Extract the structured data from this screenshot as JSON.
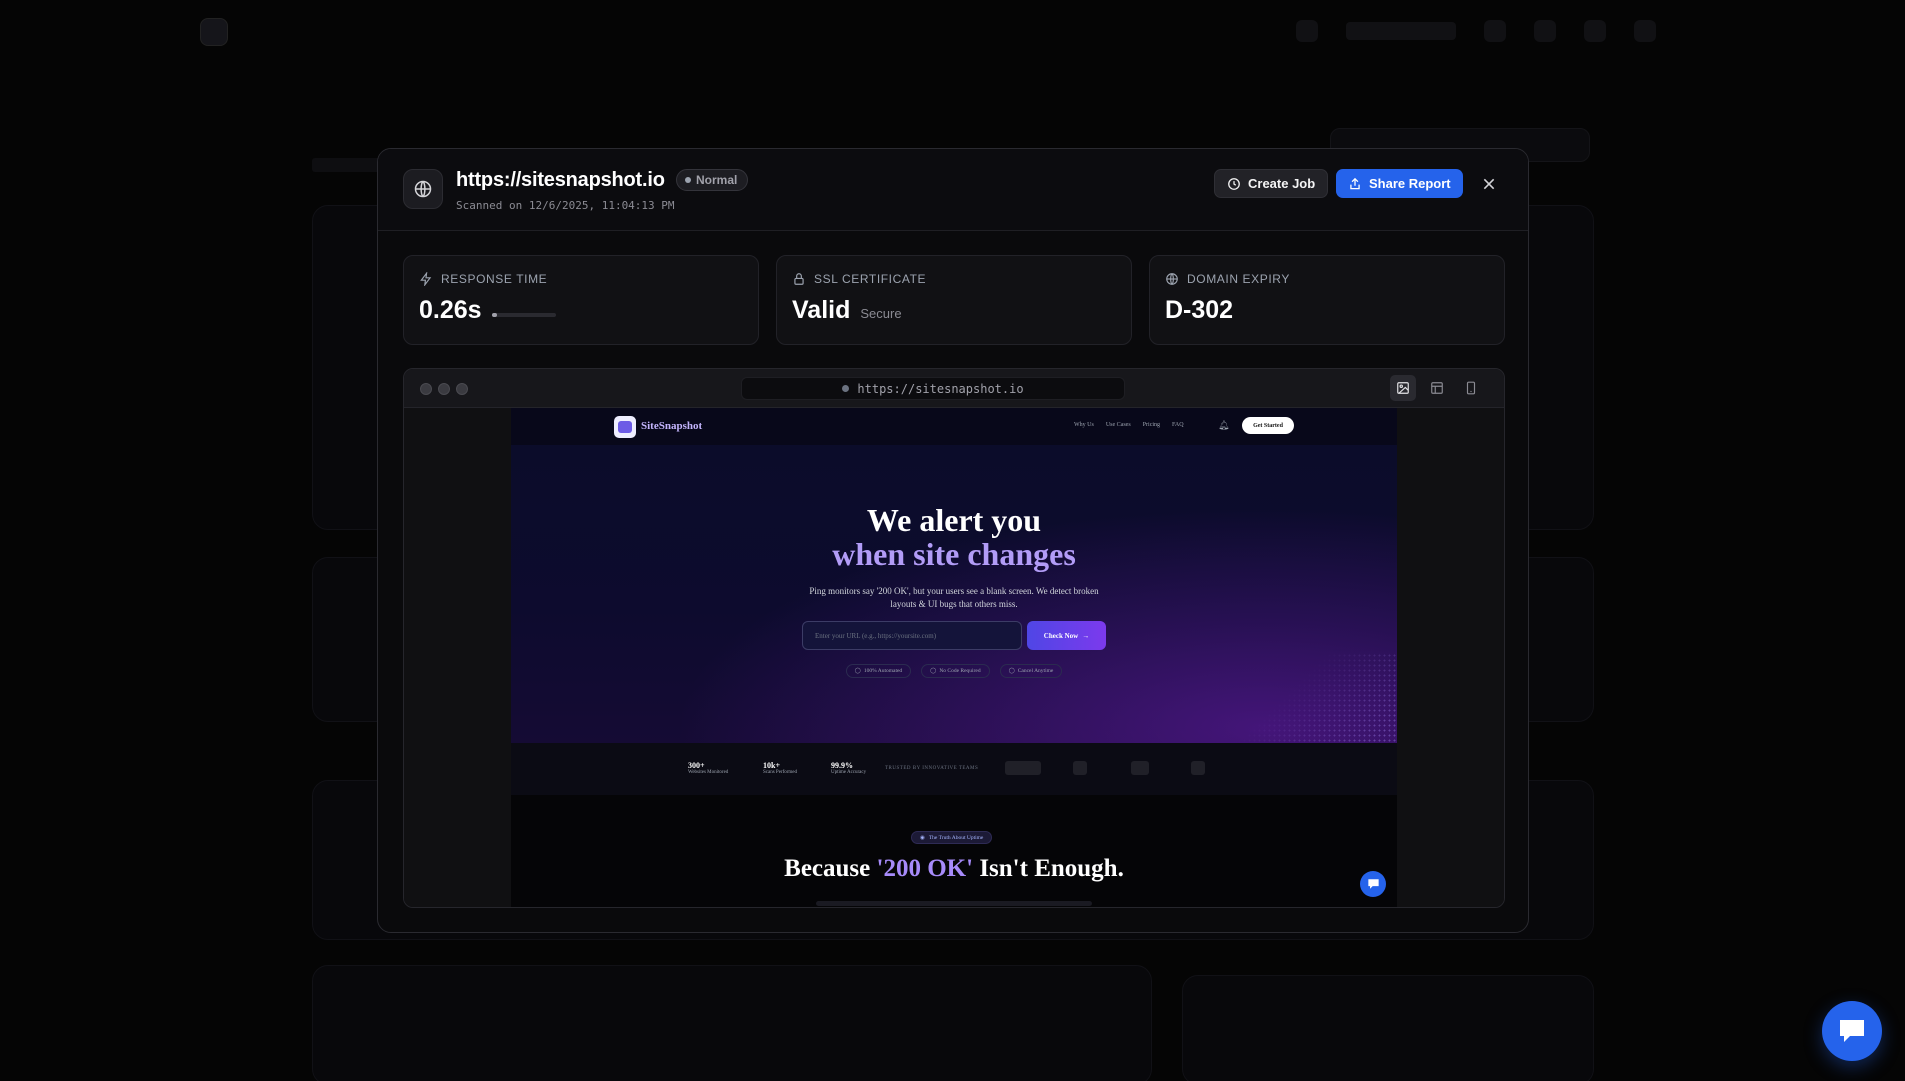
{
  "modal": {
    "url": "https://sitesnapshot.io",
    "status_badge": "Normal",
    "scanned": "Scanned on 12/6/2025, 11:04:13 PM",
    "create_job_label": "Create Job",
    "share_report_label": "Share Report"
  },
  "stats": [
    {
      "label": "RESPONSE TIME",
      "value": "0.26s",
      "progress": 0.05,
      "icon": "zap-icon"
    },
    {
      "label": "SSL CERTIFICATE",
      "value": "Valid",
      "secondary": "Secure",
      "icon": "lock-icon"
    },
    {
      "label": "DOMAIN EXPIRY",
      "value": "D-302",
      "icon": "globe-icon"
    }
  ],
  "browser": {
    "address": "https://sitesnapshot.io",
    "view_modes": [
      "image-view-icon",
      "layout-view-icon",
      "mobile-view-icon"
    ],
    "active_view": "image-view-icon"
  },
  "snapshot": {
    "brand": "SiteSnapshot",
    "nav_links": [
      "Why Us",
      "Use Cases",
      "Pricing",
      "FAQ"
    ],
    "cta": "Get Started",
    "headline_1": "We alert you",
    "headline_2": "when site changes",
    "paragraph": "Ping monitors say '200 OK', but your users see a blank screen. We detect broken layouts & UI bugs that others miss.",
    "input_placeholder": "Enter your URL (e.g., https://yoursite.com)",
    "check_button": "Check Now",
    "pills": [
      "100% Automated",
      "No Code Required",
      "Cancel Anytime"
    ],
    "stats": [
      {
        "value": "300+",
        "label": "Websites Monitored"
      },
      {
        "value": "10k+",
        "label": "Scans Performed"
      },
      {
        "value": "99.9%",
        "label": "Uptime Accuracy"
      }
    ],
    "trusted": "TRUSTED BY INNOVATIVE TEAMS",
    "section_tag": "The Truth About Uptime",
    "section_title_pre": "Because ",
    "section_title_highlight": "'200 OK'",
    "section_title_post": " Isn't Enough."
  },
  "colors": {
    "accent": "#2563eb",
    "modal_bg": "#0a0a0c",
    "highlight_purple": "#a78bfa"
  }
}
